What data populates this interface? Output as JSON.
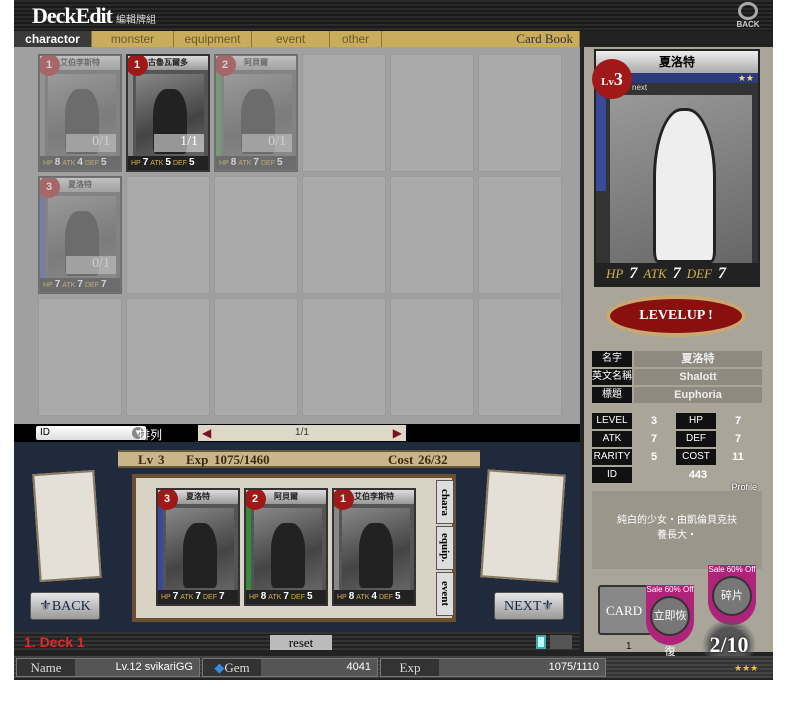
{
  "header": {
    "title": "DeckEdit",
    "subtitle": "編輯牌組",
    "back_label": "BACK"
  },
  "tabs": [
    {
      "label": "charactor",
      "active": true
    },
    {
      "label": "monster"
    },
    {
      "label": "equipment"
    },
    {
      "label": "event"
    },
    {
      "label": "other"
    }
  ],
  "card_book_label": "Card Book",
  "grid_cards": [
    {
      "name": "艾伯李斯特",
      "level": "1",
      "count": "0/1",
      "hp": "8",
      "atk": "4",
      "def": "5",
      "dim": true,
      "color": "#777"
    },
    {
      "name": "古魯瓦爾多",
      "level": "1",
      "count": "1/1",
      "hp": "7",
      "atk": "5",
      "def": "5",
      "dim": false,
      "color": "#888"
    },
    {
      "name": "阿貝爾",
      "level": "2",
      "count": "0/1",
      "hp": "8",
      "atk": "7",
      "def": "5",
      "dim": true,
      "color": "#3a8a3a"
    },
    {
      "name": "夏洛特",
      "level": "3",
      "count": "0/1",
      "hp": "7",
      "atk": "7",
      "def": "7",
      "dim": true,
      "color": "#3a4a9a"
    }
  ],
  "sort": {
    "selected": "ID",
    "label": "排列",
    "page": "1/1",
    "prev_icon": "◀",
    "next_icon": "▶"
  },
  "deck": {
    "lv_label": "Lv",
    "lv": "3",
    "exp_label": "Exp",
    "exp": "1075/1460",
    "cost_label": "Cost",
    "cost": "26/32",
    "cards": [
      {
        "name": "夏洛特",
        "level": "3",
        "hp": "7",
        "atk": "7",
        "def": "7",
        "color": "#3a4a9a"
      },
      {
        "name": "阿貝爾",
        "level": "2",
        "hp": "8",
        "atk": "7",
        "def": "5",
        "color": "#3a8a3a"
      },
      {
        "name": "艾伯李斯特",
        "level": "1",
        "hp": "8",
        "atk": "4",
        "def": "5",
        "color": "#888"
      }
    ],
    "side_tabs": [
      "chara",
      "equip.",
      "event"
    ],
    "back_label": "BACK",
    "next_label": "NEXT",
    "name": "1.  Deck 1",
    "reset_label": "reset"
  },
  "stat_labels": {
    "hp": "HP",
    "atk": "ATK",
    "def": "DEF",
    "lv": "Lv"
  },
  "detail": {
    "name": "夏洛特",
    "level": "3",
    "stars": "★★",
    "next_label": "next",
    "hp": "7",
    "atk": "7",
    "def": "7",
    "levelup_label": "LEVELUP !",
    "info": [
      {
        "k": "名字",
        "v": "夏洛特"
      },
      {
        "k": "英文名稱",
        "v": "Shalott"
      },
      {
        "k": "標題",
        "v": "Euphoria"
      }
    ],
    "stats": [
      {
        "k": "LEVEL",
        "v": "3"
      },
      {
        "k": "HP",
        "v": "7"
      },
      {
        "k": "ATK",
        "v": "7"
      },
      {
        "k": "DEF",
        "v": "7"
      },
      {
        "k": "RARITY",
        "v": "5"
      },
      {
        "k": "COST",
        "v": "11"
      },
      {
        "k": "ID",
        "v": "443"
      }
    ],
    "profile_label": "Profile",
    "profile": "純白的少女・由凱倫貝克扶\n養長大・"
  },
  "shop": {
    "card_plus": "CARD +",
    "card_plus_count": "1",
    "sale1": "Sale 60% Off",
    "sale1_btn": "立即恢復",
    "sale2": "Sale 60% Off",
    "sale2_btn": "碎片GET",
    "stamina": "2/10",
    "stars": "★★★"
  },
  "player": {
    "name_label": "Name",
    "name": "Lv.12 svikariGG",
    "gem_label": "Gem",
    "gem": "4041",
    "exp_label": "Exp",
    "exp": "1075/1110"
  }
}
